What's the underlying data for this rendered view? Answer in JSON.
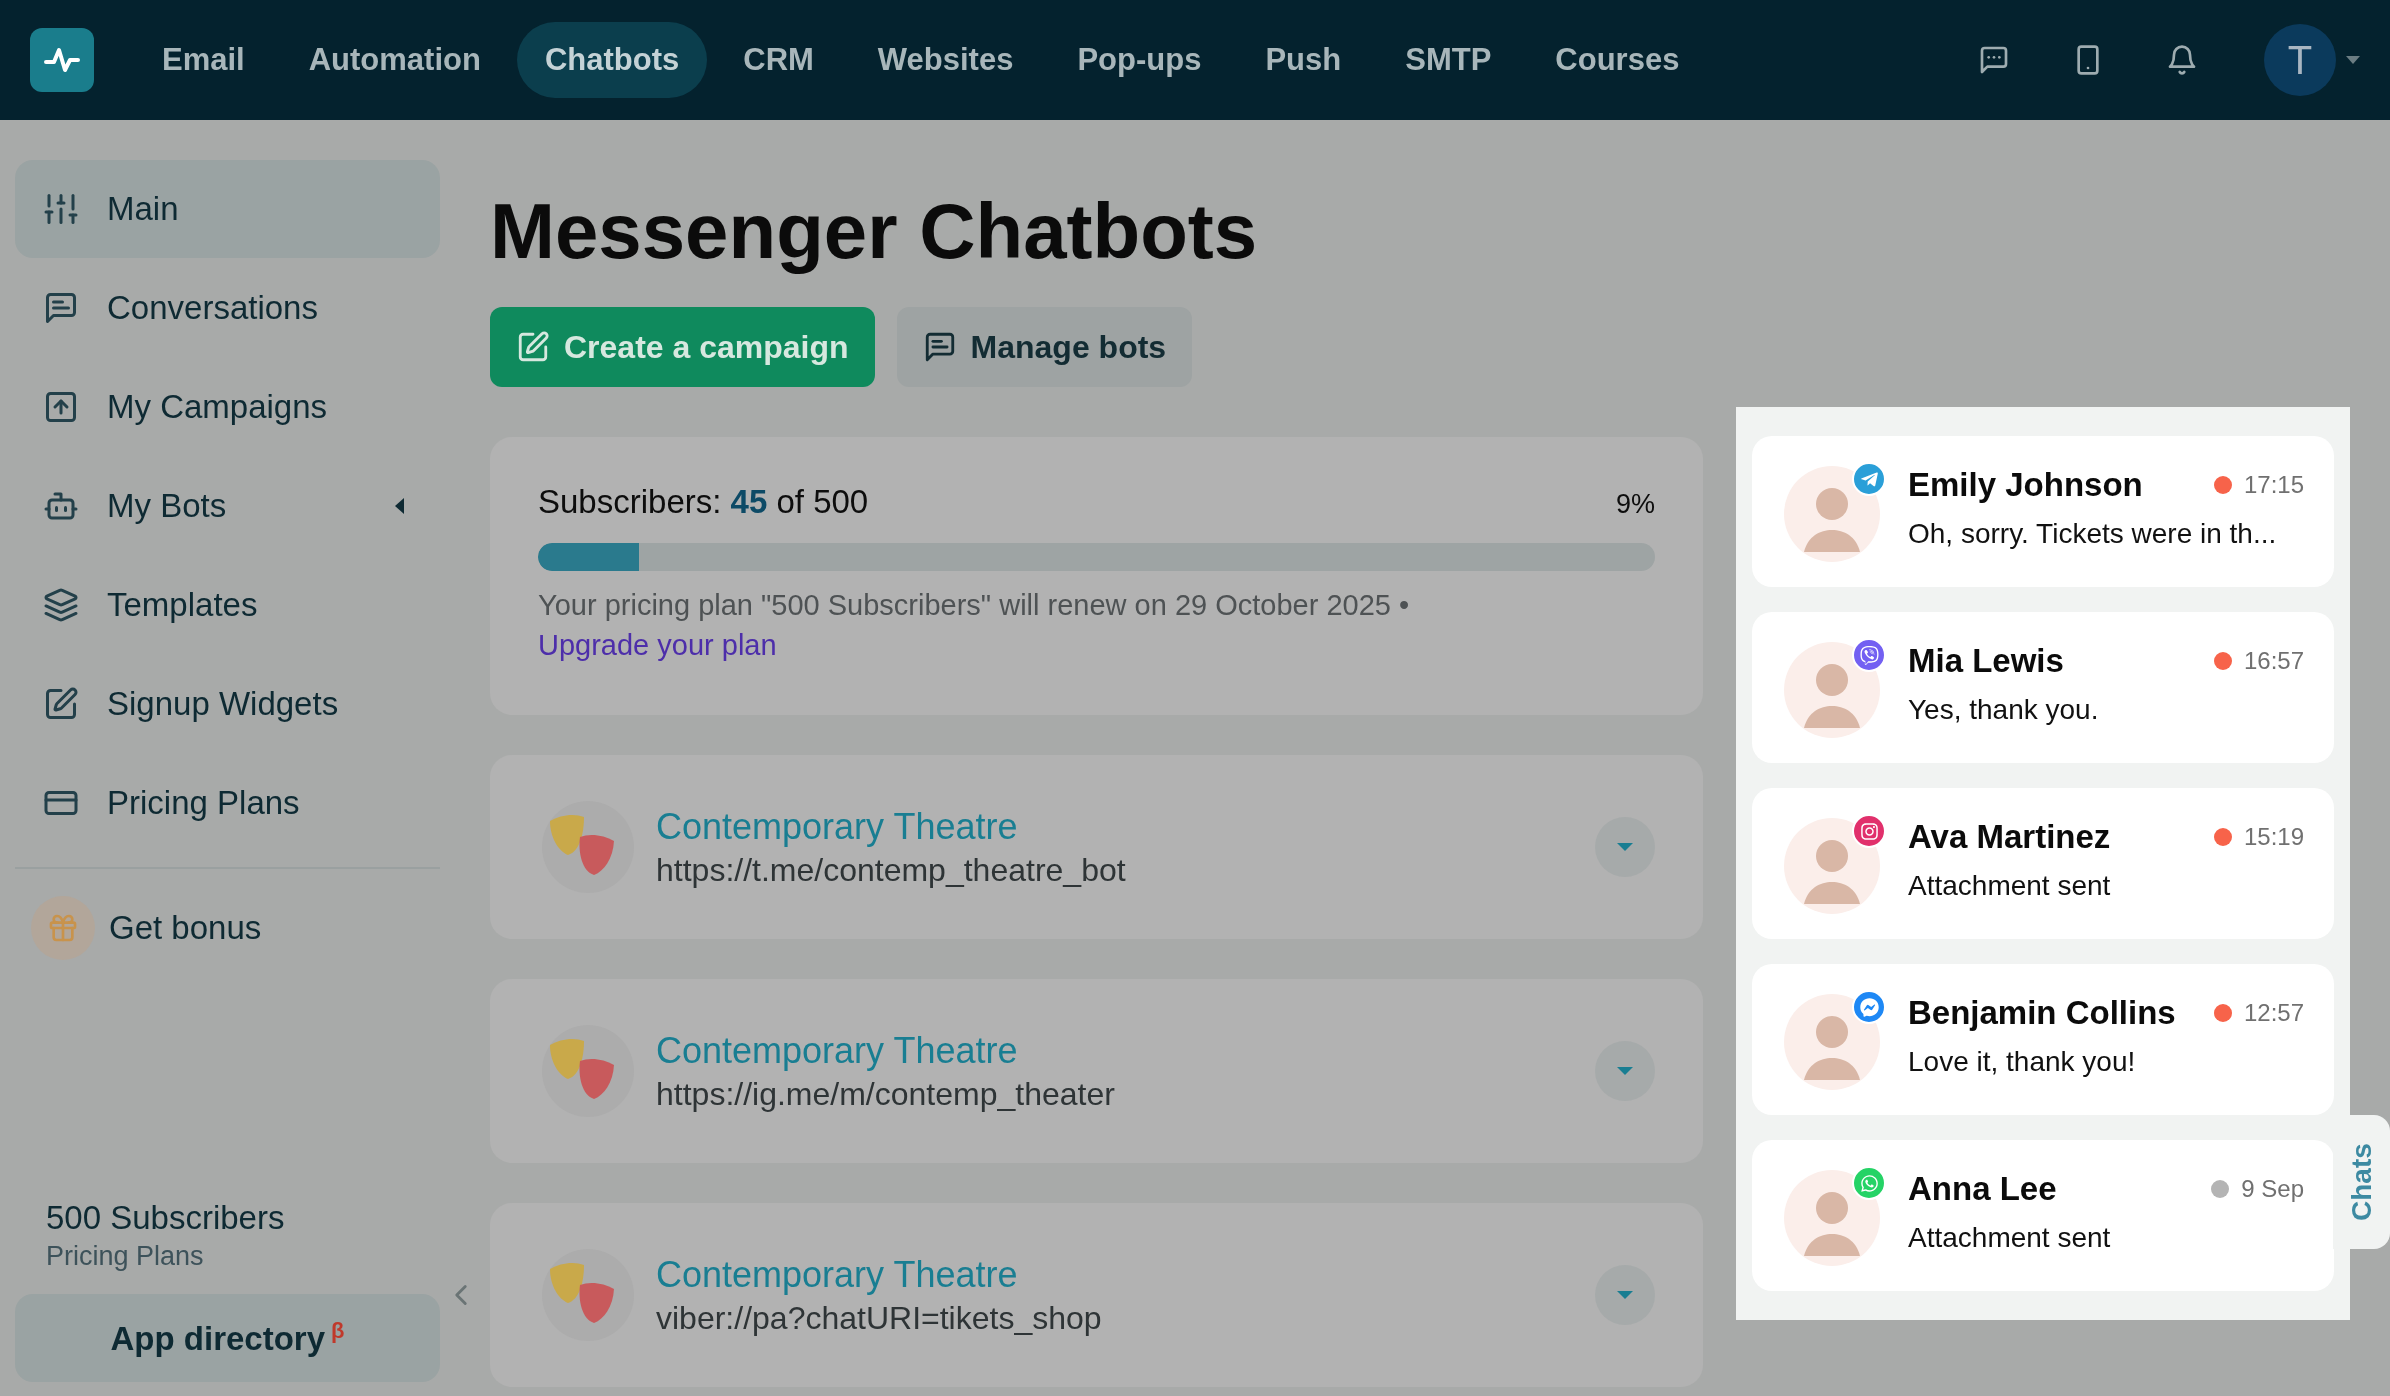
{
  "top_nav": {
    "items": [
      {
        "label": "Email",
        "selected": false
      },
      {
        "label": "Automation",
        "selected": false
      },
      {
        "label": "Chatbots",
        "selected": true
      },
      {
        "label": "CRM",
        "selected": false
      },
      {
        "label": "Websites",
        "selected": false
      },
      {
        "label": "Pop-ups",
        "selected": false
      },
      {
        "label": "Push",
        "selected": false
      },
      {
        "label": "SMTP",
        "selected": false
      },
      {
        "label": "Courses",
        "selected": false
      }
    ],
    "user_initial": "T"
  },
  "sidebar": {
    "items": [
      {
        "label": "Main",
        "selected": true
      },
      {
        "label": "Conversations",
        "selected": false
      },
      {
        "label": "My Campaigns",
        "selected": false
      },
      {
        "label": "My Bots",
        "selected": false,
        "expanded": false
      },
      {
        "label": "Templates",
        "selected": false
      },
      {
        "label": "Signup Widgets",
        "selected": false
      },
      {
        "label": "Pricing Plans",
        "selected": false
      }
    ],
    "bonus": "Get bonus",
    "plan_name": "500 Subscribers",
    "plan_link": "Pricing Plans",
    "app_directory": "App directory$^{β}$"
  },
  "page": {
    "title": "Messenger Chatbots",
    "buttons": [
      {
        "label": "Create a campaign",
        "kind": "primary"
      },
      {
        "label": "Manage bots",
        "kind": "secondary"
      }
    ],
    "subscribers": {
      "label": "Subscribers:",
      "count": "45",
      "of": "of 500",
      "percent": "9%",
      "level": 0.09,
      "note": "Your pricing plan \"500 Subscribers\" will renew on 29 October 2025 •",
      "link": "Upgrade your plan"
    },
    "bots": [
      {
        "name": "Contemporary Theatre",
        "url": "https://t.me/contemp_theatre_bot"
      },
      {
        "name": "Contemporary Theatre",
        "url": "https://ig.me/m/contemp_theater"
      },
      {
        "name": "Contemporary Theatre",
        "url": "viber://pa?chatURI=tikets_shop"
      }
    ]
  },
  "chats": {
    "tab": "Chats",
    "items": [
      {
        "name": "Emily Johnson",
        "message": "Oh, sorry. Tickets were in th...",
        "time": "17:15",
        "kind": "telegram",
        "color": "#f7634a"
      },
      {
        "name": "Mia Lewis",
        "message": "Yes, thank you.",
        "time": "16:57",
        "kind": "viber",
        "color": "#f7634a"
      },
      {
        "name": "Ava Martinez",
        "message": "Attachment sent",
        "time": "15:19",
        "kind": "instagram",
        "color": "#f7634a"
      },
      {
        "name": "Benjamin Collins",
        "message": "Love it, thank you!",
        "time": "12:57",
        "kind": "messenger",
        "color": "#f7634a"
      },
      {
        "name": "Anna Lee",
        "message": "Attachment sent",
        "time": "9 Sep",
        "kind": "whatsapp",
        "color": "#b4b4b4"
      }
    ]
  }
}
